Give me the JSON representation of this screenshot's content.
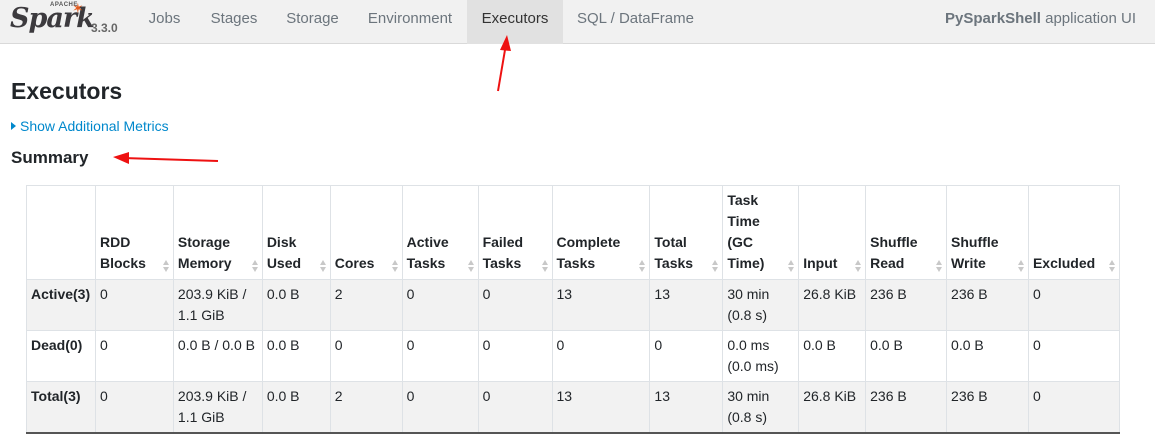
{
  "brand": {
    "apache": "APACHE",
    "name": "Spark",
    "version": "3.3.0"
  },
  "nav": {
    "tabs": [
      "Jobs",
      "Stages",
      "Storage",
      "Environment",
      "Executors",
      "SQL / DataFrame"
    ],
    "active": "Executors",
    "app_name": "PySparkShell",
    "app_suffix": " application UI"
  },
  "page": {
    "title": "Executors",
    "metrics_link": "Show Additional Metrics",
    "summary_title": "Summary"
  },
  "summary_table": {
    "headers": [
      "",
      "RDD Blocks",
      "Storage Memory",
      "Disk Used",
      "Cores",
      "Active Tasks",
      "Failed Tasks",
      "Complete Tasks",
      "Total Tasks",
      "Task Time (GC Time)",
      "Input",
      "Shuffle Read",
      "Shuffle Write",
      "Excluded"
    ],
    "rows": [
      [
        "Active(3)",
        "0",
        "203.9 KiB / 1.1 GiB",
        "0.0 B",
        "2",
        "0",
        "0",
        "13",
        "13",
        "30 min (0.8 s)",
        "26.8 KiB",
        "236 B",
        "236 B",
        "0"
      ],
      [
        "Dead(0)",
        "0",
        "0.0 B / 0.0 B",
        "0.0 B",
        "0",
        "0",
        "0",
        "0",
        "0",
        "0.0 ms (0.0 ms)",
        "0.0 B",
        "0.0 B",
        "0.0 B",
        "0"
      ],
      [
        "Total(3)",
        "0",
        "203.9 KiB / 1.1 GiB",
        "0.0 B",
        "2",
        "0",
        "0",
        "13",
        "13",
        "30 min (0.8 s)",
        "26.8 KiB",
        "236 B",
        "236 B",
        "0"
      ]
    ]
  },
  "colors": {
    "link": "#0088cc",
    "annotation": "#ee1111",
    "navbar": "#f1f1f1",
    "active_tab": "#e1e1e1"
  }
}
